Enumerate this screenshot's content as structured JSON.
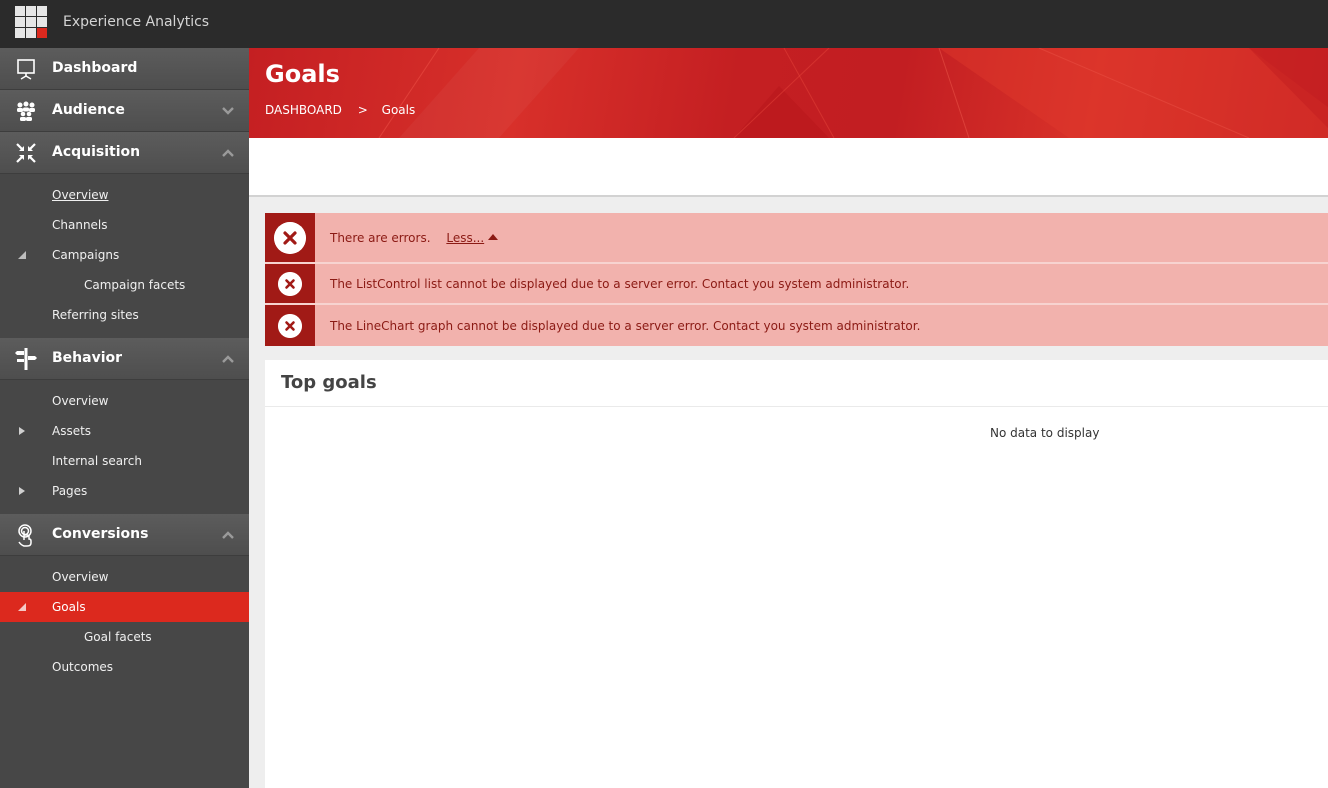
{
  "app": {
    "title": "Experience Analytics",
    "logo_icon": "app-grid-logo-icon"
  },
  "colors": {
    "accent": "#dc291e",
    "topbar": "#2b2b2b",
    "sidebar": "#474747",
    "error_bg": "#f2b2ad",
    "error_icon_bg": "#a11a16",
    "error_text": "#8b1a14"
  },
  "sidebar": {
    "sections": [
      {
        "label": "Dashboard",
        "icon": "presentation-board-icon",
        "chevron": null,
        "items": []
      },
      {
        "label": "Audience",
        "icon": "people-group-icon",
        "chevron": "chevron-down-icon",
        "items": []
      },
      {
        "label": "Acquisition",
        "icon": "arrows-inward-icon",
        "chevron": "chevron-up-icon",
        "items": [
          {
            "label": "Overview",
            "level": 1,
            "current": true
          },
          {
            "label": "Channels",
            "level": 1
          },
          {
            "label": "Campaigns",
            "level": 1,
            "expander": "expanded"
          },
          {
            "label": "Campaign facets",
            "level": 2
          },
          {
            "label": "Referring sites",
            "level": 1
          }
        ]
      },
      {
        "label": "Behavior",
        "icon": "signpost-icon",
        "chevron": "chevron-up-icon",
        "items": [
          {
            "label": "Overview",
            "level": 1
          },
          {
            "label": "Assets",
            "level": 1,
            "expander": "collapsed"
          },
          {
            "label": "Internal search",
            "level": 1
          },
          {
            "label": "Pages",
            "level": 1,
            "expander": "collapsed"
          }
        ]
      },
      {
        "label": "Conversions",
        "icon": "touch-hand-icon",
        "chevron": "chevron-up-icon",
        "items": [
          {
            "label": "Overview",
            "level": 1
          },
          {
            "label": "Goals",
            "level": 1,
            "expander": "expanded",
            "active": true
          },
          {
            "label": "Goal facets",
            "level": 2
          },
          {
            "label": "Outcomes",
            "level": 1
          }
        ]
      }
    ]
  },
  "header": {
    "title": "Goals",
    "breadcrumb": [
      {
        "label": "DASHBOARD"
      },
      {
        "label": "Goals"
      }
    ],
    "breadcrumb_separator": ">"
  },
  "errors": {
    "summary": "There are errors.",
    "toggle_label": "Less...",
    "messages": [
      "The ListControl list cannot be displayed due to a server error. Contact you system administrator.",
      "The LineChart graph cannot be displayed due to a server error. Contact you system administrator."
    ]
  },
  "panel": {
    "title": "Top goals",
    "empty_text": "No data to display"
  }
}
